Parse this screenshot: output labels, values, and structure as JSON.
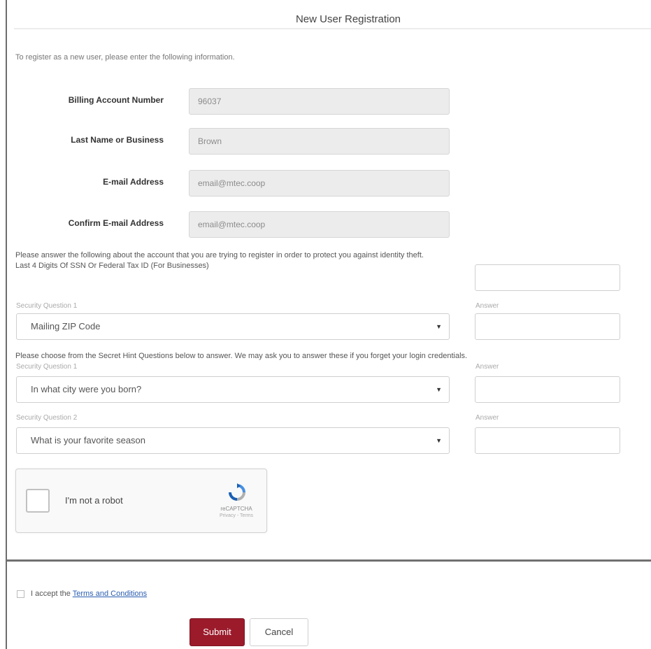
{
  "title": "New User Registration",
  "intro": "To register as a new user, please enter the following information.",
  "fields": [
    {
      "label": "Billing Account Number",
      "value": "96037"
    },
    {
      "label": "Last Name or Business",
      "value": "Brown"
    },
    {
      "label": "E-mail Address",
      "value": "email@mtec.coop"
    },
    {
      "label": "Confirm E-mail Address",
      "value": "email@mtec.coop"
    }
  ],
  "identity": {
    "prompt": "Please answer the following about the account that you are trying to register in order to protect you against identity theft.",
    "ssn_label": "Last 4 Digits Of SSN Or Federal Tax ID (For Businesses)",
    "question_label": "Security Question 1",
    "question_value": "Mailing ZIP Code",
    "answer_label": "Answer"
  },
  "secret_hints": {
    "prompt": "Please choose from the Secret Hint Questions below to answer. We may ask you to answer these if you forget your login credentials.",
    "questions": [
      {
        "label": "Security Question 1",
        "value": "In what city were you born?",
        "answer_label": "Answer"
      },
      {
        "label": "Security Question 2",
        "value": "What is your favorite season",
        "answer_label": "Answer"
      }
    ]
  },
  "captcha": {
    "label": "I'm not a robot",
    "brand": "reCAPTCHA",
    "links": "Privacy - Terms"
  },
  "terms": {
    "prefix": "I accept the ",
    "link": "Terms and Conditions"
  },
  "buttons": {
    "submit": "Submit",
    "cancel": "Cancel"
  },
  "colors": {
    "submit_bg": "#9b1b2b",
    "link": "#2a5db0",
    "readonly_bg": "#ececec"
  }
}
